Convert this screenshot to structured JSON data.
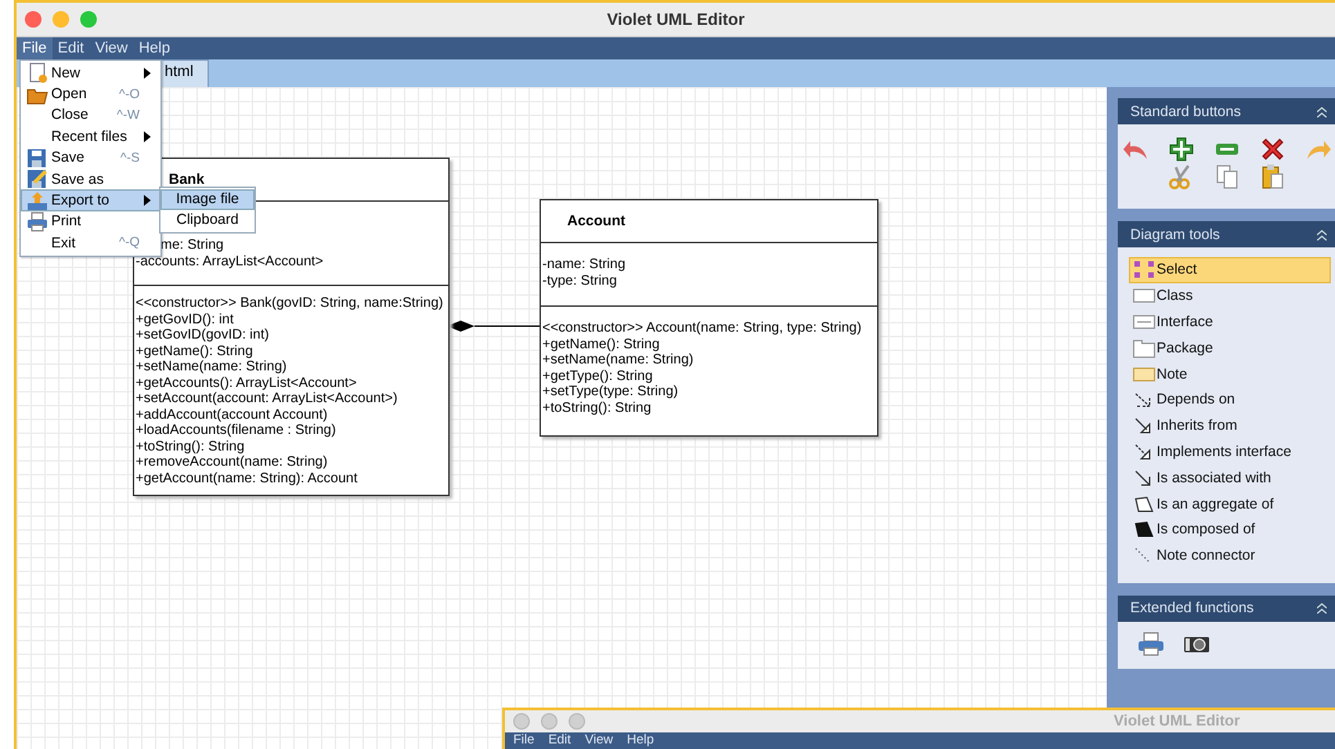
{
  "window": {
    "title": "Violet UML Editor"
  },
  "menu_bar": [
    {
      "label": "File",
      "selected": true
    },
    {
      "label": "Edit",
      "selected": false
    },
    {
      "label": "View",
      "selected": false
    },
    {
      "label": "Help",
      "selected": false
    }
  ],
  "tab": {
    "label": "html"
  },
  "file_menu": [
    {
      "label": "New",
      "kind": "new",
      "submenu": true,
      "selected": false
    },
    {
      "label": "Open",
      "kind": "open",
      "shortcut": "^-O",
      "submenu": false,
      "selected": false
    },
    {
      "label": "Close",
      "kind": "plain",
      "shortcut": "^-W",
      "submenu": false,
      "selected": false
    },
    {
      "label": "Recent files",
      "kind": "plain",
      "submenu": true,
      "selected": false
    },
    {
      "label": "Save",
      "kind": "save",
      "shortcut": "^-S",
      "submenu": false,
      "selected": false
    },
    {
      "label": "Save as",
      "kind": "saveas",
      "submenu": false,
      "selected": false
    },
    {
      "label": "Export to",
      "kind": "export",
      "submenu": true,
      "selected": true
    },
    {
      "label": "Print",
      "kind": "print",
      "submenu": false,
      "selected": false
    },
    {
      "label": "Exit",
      "kind": "plain",
      "shortcut": "^-Q",
      "submenu": false,
      "selected": false
    }
  ],
  "export_submenu": [
    {
      "label": "Image file",
      "selected": true
    },
    {
      "label": "Clipboard",
      "selected": false
    }
  ],
  "classes": [
    {
      "name": "Bank",
      "attributes": [
        {
          "text": "me: String",
          "covered": true
        },
        {
          "text": "-accounts: ArrayList<Account>",
          "covered": false
        }
      ],
      "methods": [
        "<<constructor>> Bank(govID: String, name:String)",
        "+getGovID(): int",
        "+setGovID(govID: int)",
        "+getName(): String",
        "+setName(name: String)",
        "+getAccounts(): ArrayList<Account>",
        "+setAccount(account: ArrayList<Account>)",
        "+addAccount(account Account)",
        "+loadAccounts(filename : String)",
        "+toString(): String",
        "+removeAccount(name: String)",
        "+getAccount(name: String): Account"
      ]
    },
    {
      "name": "Account",
      "attributes": [
        {
          "text": "-name: String",
          "covered": false
        },
        {
          "text": "-type: String",
          "covered": false
        }
      ],
      "methods": [
        "<<constructor>> Account(name: String, type: String)",
        "+getName(): String",
        "+setName(name: String)",
        "+getType(): String",
        "+setType(type: String)",
        "+toString(): String"
      ]
    }
  ],
  "panels": [
    {
      "title": "Standard buttons"
    },
    {
      "title": "Diagram tools"
    },
    {
      "title": "Extended functions"
    }
  ],
  "diagram_tools": [
    {
      "label": "Select",
      "kind": "select",
      "selected": true
    },
    {
      "label": "Class",
      "kind": "class",
      "selected": false
    },
    {
      "label": "Interface",
      "kind": "interface",
      "selected": false
    },
    {
      "label": "Package",
      "kind": "package",
      "selected": false
    },
    {
      "label": "Note",
      "kind": "note",
      "selected": false
    },
    {
      "label": "Depends on",
      "kind": "dependency",
      "selected": false
    },
    {
      "label": "Inherits from",
      "kind": "inheritance",
      "selected": false
    },
    {
      "label": "Implements interface",
      "kind": "realization",
      "selected": false
    },
    {
      "label": "Is associated with",
      "kind": "association",
      "selected": false
    },
    {
      "label": "Is an aggregate of",
      "kind": "aggregation",
      "selected": false
    },
    {
      "label": "Is composed of",
      "kind": "composition",
      "selected": false
    },
    {
      "label": "Note connector",
      "kind": "noteconnector",
      "selected": false
    }
  ],
  "second_window": {
    "title": "Violet UML Editor",
    "menu_bar": [
      "File",
      "Edit",
      "View",
      "Help"
    ]
  }
}
